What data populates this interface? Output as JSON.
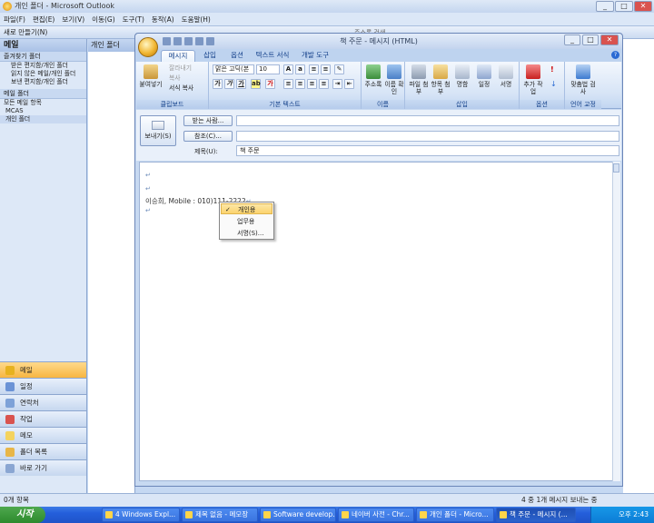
{
  "outlook": {
    "title": "개인 폴더 - Microsoft Outlook",
    "menu": [
      "파일(F)",
      "편집(E)",
      "보기(V)",
      "이동(G)",
      "도구(T)",
      "동작(A)",
      "도움말(H)"
    ],
    "toolbar": {
      "new": "새로 만들기(N)",
      "addr_search": "주소록 검색",
      "folder_tab": "개인 폴더"
    }
  },
  "nav": {
    "header": "메일",
    "favorites": "즐겨찾기 폴더",
    "fav_items": [
      "받은 편지함/개인 폴더",
      "읽지 않은 메일/개인 폴더",
      "보낸 편지함/개인 폴더"
    ],
    "mail_folders": "메일 폴더",
    "all_items": "모든 메일 항목",
    "tree": [
      "MCAS",
      "개인 폴더"
    ],
    "buttons": [
      "메일",
      "일정",
      "연락처",
      "작업",
      "메모",
      "폴더 목록",
      "바로 가기"
    ]
  },
  "status": {
    "left": "0개 항목",
    "right": "4 중 1개 메시지 보내는 중"
  },
  "taskbar": {
    "start": "시작",
    "items": [
      "4 Windows Expl...",
      "제목 없음 - 메모장",
      "Software develop...",
      "네이버 사전 - Chr...",
      "개인 폴더 - Micro...",
      "책 주문 - 메시지 (..."
    ],
    "clock": "오후 2:43"
  },
  "message": {
    "title": "책 주문 - 메시지 (HTML)",
    "tabs": [
      "메시지",
      "삽입",
      "옵션",
      "텍스트 서식",
      "개발 도구"
    ],
    "ribbon": {
      "clipboard": {
        "label": "클립보드",
        "paste": "붙여넣기",
        "cut": "잘라내기",
        "copy": "복사",
        "format_copy": "서식 복사"
      },
      "text": {
        "label": "기본 텍스트",
        "font": "맑은 고딕(본",
        "size": "10"
      },
      "names": {
        "label": "이름",
        "address": "주소록",
        "check": "이름 확인"
      },
      "insert": {
        "label": "삽입",
        "attach_file": "파일 첨부",
        "attach_item": "항목 첨부",
        "card": "명함",
        "calendar": "일정",
        "signature": "서명"
      },
      "options": {
        "label": "옵션",
        "followup": "추가 작업"
      },
      "proof": {
        "label": "언어 교정",
        "spell": "맞춤법 검사"
      }
    },
    "fields": {
      "send": "보내기(S)",
      "to": "받는 사람...",
      "cc": "참조(C)...",
      "subject_label": "제목(U):",
      "subject_value": "책 주문"
    },
    "body_line": "이승희, Mobile : 010)111-2222",
    "context_menu": [
      "개인용",
      "업무용",
      "서명(S)..."
    ]
  }
}
